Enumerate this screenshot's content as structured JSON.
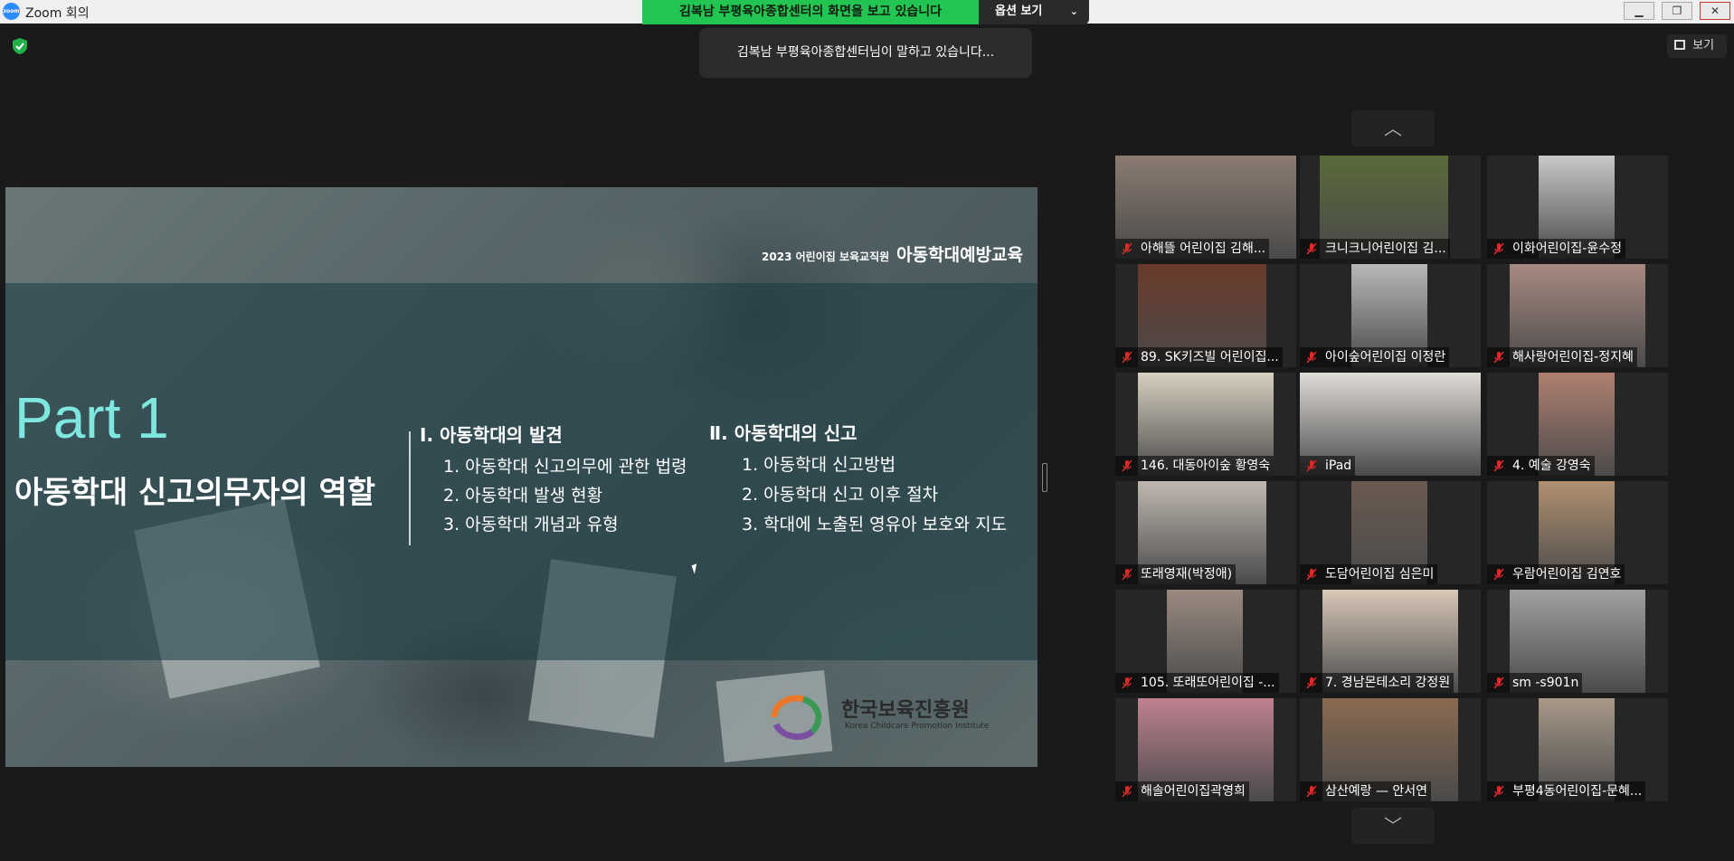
{
  "window": {
    "title": "Zoom 회의",
    "app_icon_text": "zoom"
  },
  "share_banner": {
    "text": "김복남 부평육아종합센터의 화면을 보고 있습니다",
    "options_label": "옵션 보기"
  },
  "speaking_indicator": "김복남 부평육아종합센터님이 말하고 있습니다...",
  "view_button": {
    "label": "보기",
    "icon": "grid-icon"
  },
  "slide": {
    "small_caption": "2023 어린이집 보육교직원",
    "big_caption": "아동학대예방교육",
    "part": "Part 1",
    "role": "아동학대 신고의무자의 역할",
    "sections": [
      {
        "heading": "Ⅰ. 아동학대의 발견",
        "items": [
          "1. 아동학대 신고의무에 관한 법령",
          "2. 아동학대 발생 현황",
          "3. 아동학대 개념과 유형"
        ]
      },
      {
        "heading": "Ⅱ. 아동학대의 신고",
        "items": [
          "1. 아동학대 신고방법",
          "2. 아동학대 신고 이후 절차",
          "3. 학대에 노출된 영유아 보호와 지도"
        ]
      }
    ],
    "logo_text": "한국보육진흥원",
    "logo_sub": "Korea Childcare Promotion Institute"
  },
  "gallery": {
    "nav_up_icon": "chevron-up-icon",
    "nav_down_icon": "chevron-down-icon",
    "participants": [
      {
        "name": "아해뜰 어린이집 김해...",
        "muted": true
      },
      {
        "name": "크니크니어린이집 김...",
        "muted": true
      },
      {
        "name": "이화어린이집-윤수정",
        "muted": true
      },
      {
        "name": "89. SK키즈빌 어린이집...",
        "muted": true
      },
      {
        "name": "아이숲어린이집 이정란",
        "muted": true
      },
      {
        "name": "해사랑어린이집-정지혜",
        "muted": true
      },
      {
        "name": "146. 대동아이숲 황영숙",
        "muted": true
      },
      {
        "name": "iPad",
        "muted": true
      },
      {
        "name": "4. 예술 강영숙",
        "muted": true
      },
      {
        "name": "또래영재(박정애)",
        "muted": true
      },
      {
        "name": "도담어린이집 심은미",
        "muted": true
      },
      {
        "name": "우람어린이집 김연호",
        "muted": true
      },
      {
        "name": "105. 또래또어린이집 -...",
        "muted": true
      },
      {
        "name": "7. 경남몬테소리 강정원",
        "muted": true
      },
      {
        "name": "sm -s901n",
        "muted": true
      },
      {
        "name": "해솔어린이집곽영희",
        "muted": true
      },
      {
        "name": "삼산예랑 — 안서연",
        "muted": true
      },
      {
        "name": "부평4동어린이집-문혜...",
        "muted": true
      }
    ]
  },
  "colors": {
    "banner_green": "#23c552",
    "part_cyan": "#7ee8e0",
    "mute_red": "#e02828"
  }
}
